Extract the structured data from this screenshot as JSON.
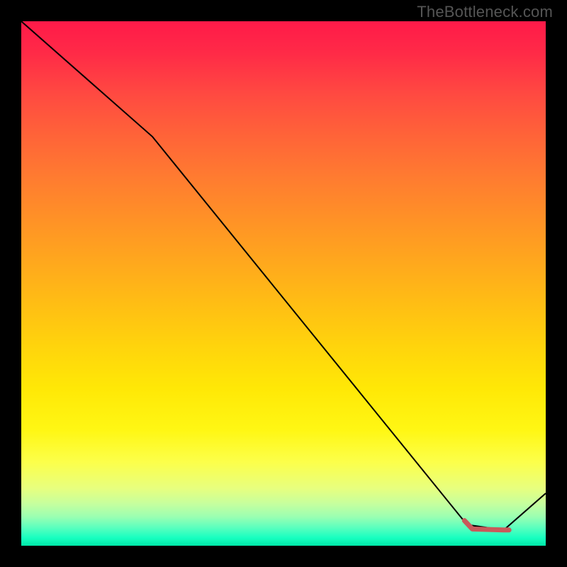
{
  "watermark": "TheBottleneck.com",
  "chart_data": {
    "type": "line",
    "title": "",
    "xlabel": "",
    "ylabel": "",
    "xlim": [
      0,
      100
    ],
    "ylim": [
      0,
      100
    ],
    "series": [
      {
        "name": "main-curve",
        "color": "#000000",
        "stroke_width": 2,
        "x": [
          0,
          25,
          85,
          92,
          100
        ],
        "y": [
          100,
          78,
          4,
          3,
          10
        ]
      },
      {
        "name": "highlight-segment",
        "color": "#c85a5a",
        "stroke_width": 7,
        "linecap": "round",
        "x": [
          84.5,
          86,
          92,
          93
        ],
        "y": [
          4.8,
          3.2,
          3.0,
          3.0
        ]
      }
    ],
    "gradient_stops": [
      {
        "pos": 0.0,
        "color": "#ff1a49"
      },
      {
        "pos": 0.5,
        "color": "#ffb516"
      },
      {
        "pos": 0.8,
        "color": "#fbff3a"
      },
      {
        "pos": 0.95,
        "color": "#8affb2"
      },
      {
        "pos": 1.0,
        "color": "#00e8a8"
      }
    ]
  }
}
